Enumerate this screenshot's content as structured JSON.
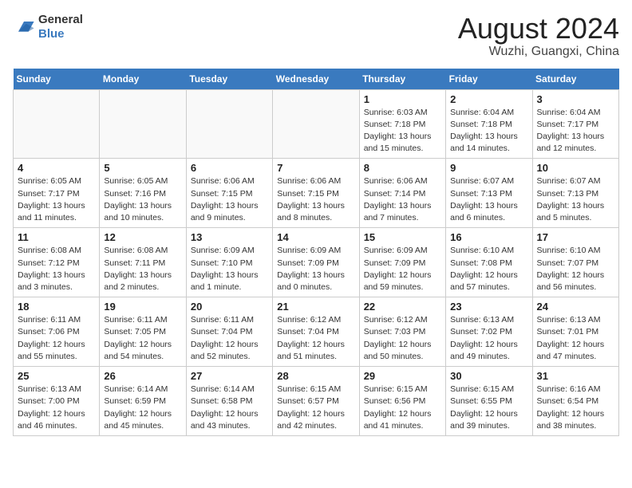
{
  "header": {
    "logo_general": "General",
    "logo_blue": "Blue",
    "title": "August 2024",
    "subtitle": "Wuzhi, Guangxi, China"
  },
  "days_of_week": [
    "Sunday",
    "Monday",
    "Tuesday",
    "Wednesday",
    "Thursday",
    "Friday",
    "Saturday"
  ],
  "weeks": [
    [
      {
        "day": "",
        "empty": true
      },
      {
        "day": "",
        "empty": true
      },
      {
        "day": "",
        "empty": true
      },
      {
        "day": "",
        "empty": true
      },
      {
        "day": "1",
        "sunrise": "6:03 AM",
        "sunset": "7:18 PM",
        "daylight": "13 hours and 15 minutes."
      },
      {
        "day": "2",
        "sunrise": "6:04 AM",
        "sunset": "7:18 PM",
        "daylight": "13 hours and 14 minutes."
      },
      {
        "day": "3",
        "sunrise": "6:04 AM",
        "sunset": "7:17 PM",
        "daylight": "13 hours and 12 minutes."
      }
    ],
    [
      {
        "day": "4",
        "sunrise": "6:05 AM",
        "sunset": "7:17 PM",
        "daylight": "13 hours and 11 minutes."
      },
      {
        "day": "5",
        "sunrise": "6:05 AM",
        "sunset": "7:16 PM",
        "daylight": "13 hours and 10 minutes."
      },
      {
        "day": "6",
        "sunrise": "6:06 AM",
        "sunset": "7:15 PM",
        "daylight": "13 hours and 9 minutes."
      },
      {
        "day": "7",
        "sunrise": "6:06 AM",
        "sunset": "7:15 PM",
        "daylight": "13 hours and 8 minutes."
      },
      {
        "day": "8",
        "sunrise": "6:06 AM",
        "sunset": "7:14 PM",
        "daylight": "13 hours and 7 minutes."
      },
      {
        "day": "9",
        "sunrise": "6:07 AM",
        "sunset": "7:13 PM",
        "daylight": "13 hours and 6 minutes."
      },
      {
        "day": "10",
        "sunrise": "6:07 AM",
        "sunset": "7:13 PM",
        "daylight": "13 hours and 5 minutes."
      }
    ],
    [
      {
        "day": "11",
        "sunrise": "6:08 AM",
        "sunset": "7:12 PM",
        "daylight": "13 hours and 3 minutes."
      },
      {
        "day": "12",
        "sunrise": "6:08 AM",
        "sunset": "7:11 PM",
        "daylight": "13 hours and 2 minutes."
      },
      {
        "day": "13",
        "sunrise": "6:09 AM",
        "sunset": "7:10 PM",
        "daylight": "13 hours and 1 minute."
      },
      {
        "day": "14",
        "sunrise": "6:09 AM",
        "sunset": "7:09 PM",
        "daylight": "13 hours and 0 minutes."
      },
      {
        "day": "15",
        "sunrise": "6:09 AM",
        "sunset": "7:09 PM",
        "daylight": "12 hours and 59 minutes."
      },
      {
        "day": "16",
        "sunrise": "6:10 AM",
        "sunset": "7:08 PM",
        "daylight": "12 hours and 57 minutes."
      },
      {
        "day": "17",
        "sunrise": "6:10 AM",
        "sunset": "7:07 PM",
        "daylight": "12 hours and 56 minutes."
      }
    ],
    [
      {
        "day": "18",
        "sunrise": "6:11 AM",
        "sunset": "7:06 PM",
        "daylight": "12 hours and 55 minutes."
      },
      {
        "day": "19",
        "sunrise": "6:11 AM",
        "sunset": "7:05 PM",
        "daylight": "12 hours and 54 minutes."
      },
      {
        "day": "20",
        "sunrise": "6:11 AM",
        "sunset": "7:04 PM",
        "daylight": "12 hours and 52 minutes."
      },
      {
        "day": "21",
        "sunrise": "6:12 AM",
        "sunset": "7:04 PM",
        "daylight": "12 hours and 51 minutes."
      },
      {
        "day": "22",
        "sunrise": "6:12 AM",
        "sunset": "7:03 PM",
        "daylight": "12 hours and 50 minutes."
      },
      {
        "day": "23",
        "sunrise": "6:13 AM",
        "sunset": "7:02 PM",
        "daylight": "12 hours and 49 minutes."
      },
      {
        "day": "24",
        "sunrise": "6:13 AM",
        "sunset": "7:01 PM",
        "daylight": "12 hours and 47 minutes."
      }
    ],
    [
      {
        "day": "25",
        "sunrise": "6:13 AM",
        "sunset": "7:00 PM",
        "daylight": "12 hours and 46 minutes."
      },
      {
        "day": "26",
        "sunrise": "6:14 AM",
        "sunset": "6:59 PM",
        "daylight": "12 hours and 45 minutes."
      },
      {
        "day": "27",
        "sunrise": "6:14 AM",
        "sunset": "6:58 PM",
        "daylight": "12 hours and 43 minutes."
      },
      {
        "day": "28",
        "sunrise": "6:15 AM",
        "sunset": "6:57 PM",
        "daylight": "12 hours and 42 minutes."
      },
      {
        "day": "29",
        "sunrise": "6:15 AM",
        "sunset": "6:56 PM",
        "daylight": "12 hours and 41 minutes."
      },
      {
        "day": "30",
        "sunrise": "6:15 AM",
        "sunset": "6:55 PM",
        "daylight": "12 hours and 39 minutes."
      },
      {
        "day": "31",
        "sunrise": "6:16 AM",
        "sunset": "6:54 PM",
        "daylight": "12 hours and 38 minutes."
      }
    ]
  ]
}
